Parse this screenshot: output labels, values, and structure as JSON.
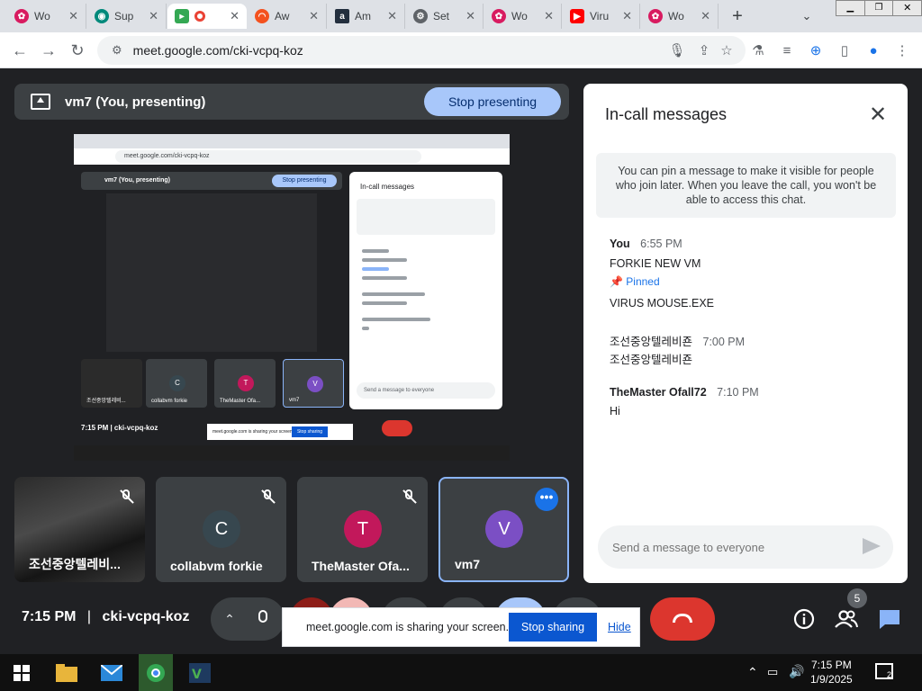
{
  "browser": {
    "tabs": [
      {
        "label": "Wo",
        "icon": "flower-icon",
        "color": "#d81b60"
      },
      {
        "label": "Sup",
        "icon": "chat-icon",
        "color": "#00897b"
      },
      {
        "label": "",
        "icon": "meet-icon",
        "color": "#34a853"
      },
      {
        "label": "Aw",
        "icon": "rainbow-icon",
        "color": "#f4511e"
      },
      {
        "label": "Am",
        "icon": "amazon-icon",
        "color": "#232f3e"
      },
      {
        "label": "Set",
        "icon": "gear-icon",
        "color": "#5f6368"
      },
      {
        "label": "Wo",
        "icon": "flower-icon",
        "color": "#d81b60"
      },
      {
        "label": "Viru",
        "icon": "youtube-icon",
        "color": "#ff0000"
      },
      {
        "label": "Wo",
        "icon": "flower-icon",
        "color": "#d81b60"
      }
    ],
    "url": "meet.google.com/cki-vcpq-koz"
  },
  "meet": {
    "presenting_label": "vm7 (You, presenting)",
    "stop_presenting": "Stop presenting",
    "participants": [
      {
        "name": "조선중앙텔레비...",
        "initial": "",
        "video": true
      },
      {
        "name": "collabvm forkie",
        "initial": "C",
        "color": "#37474f"
      },
      {
        "name": "TheMaster Ofa...",
        "initial": "T",
        "color": "#c2185b"
      },
      {
        "name": "vm7",
        "initial": "V",
        "color": "#7b4fc4"
      }
    ],
    "meeting_time": "7:15 PM",
    "meeting_code": "cki-vcpq-koz",
    "share_toast": "meet.google.com is sharing your screen.",
    "stop_sharing": "Stop sharing",
    "hide": "Hide",
    "people_count": "5",
    "warning_badge": "!"
  },
  "chat": {
    "title": "In-call messages",
    "info": "You can pin a message to make it visible for people who join later. When you leave the call, you won't be able to access this chat.",
    "messages": [
      {
        "sender": "You",
        "time": "6:55 PM",
        "lines": [
          "FORKIE NEW VM",
          "VIRUS MOUSE.EXE"
        ],
        "pinned": "Pinned"
      },
      {
        "sender": "",
        "time": "7:00 PM",
        "sender_alt": "조선중앙텔레비죤",
        "lines": [
          "조선중앙텔레비죤"
        ]
      },
      {
        "sender": "TheMaster Ofall72",
        "time": "7:10 PM",
        "lines": [
          "Hi"
        ]
      }
    ],
    "input_placeholder": "Send a message to everyone"
  },
  "shared_screen": {
    "url": "meet.google.com/cki-vcpq-koz",
    "presenting_label": "vm7 (You, presenting)",
    "stop_presenting": "Stop presenting",
    "chat_title": "In-call messages",
    "tile_names": [
      "조선중앙텔레비...",
      "collabvm forkie",
      "TheMaster Ofa...",
      "vm7"
    ],
    "tile_initials": [
      "",
      "C",
      "T",
      "V"
    ],
    "meeting_label": "7:15 PM | cki-vcpq-koz",
    "share_msg": "meet.google.com is sharing your screen.",
    "share_btn": "Stop sharing",
    "input_placeholder": "Send a message to everyone"
  },
  "taskbar": {
    "time": "7:15 PM",
    "date": "1/9/2025",
    "notifications": "2"
  }
}
